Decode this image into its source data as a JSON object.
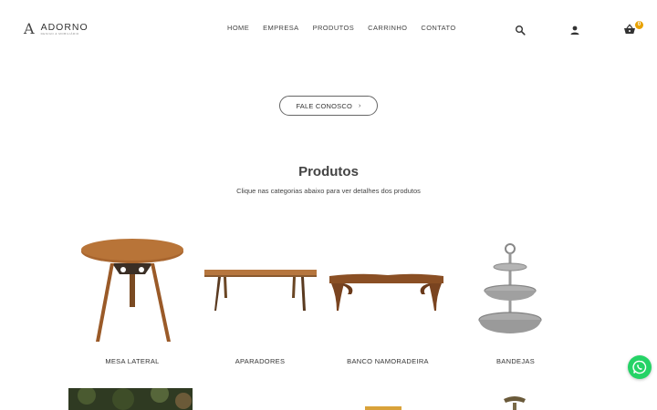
{
  "brand": {
    "name": "ADORNO",
    "tagline": "DESIGN & MOBILIÁRIO"
  },
  "nav": {
    "items": [
      "HOME",
      "EMPRESA",
      "PRODUTOS",
      "CARRINHO",
      "CONTATO"
    ]
  },
  "header": {
    "cart_count": "0",
    "accent_color": "#e8a200"
  },
  "cta": {
    "label": "FALE CONOSCO",
    "arrow": "›"
  },
  "products_section": {
    "title": "Produtos",
    "subtitle": "Clique nas categorias abaixo para ver detalhes dos produtos",
    "items": [
      {
        "label": "MESA LATERAL"
      },
      {
        "label": "APARADORES"
      },
      {
        "label": "BANCO NAMORADEIRA"
      },
      {
        "label": "BANDEJAS"
      }
    ]
  },
  "icons": [
    "search-icon",
    "user-icon",
    "basket-icon",
    "whatsapp-icon",
    "chevron-right-icon"
  ],
  "whatsapp": {
    "color": "#25d366"
  }
}
